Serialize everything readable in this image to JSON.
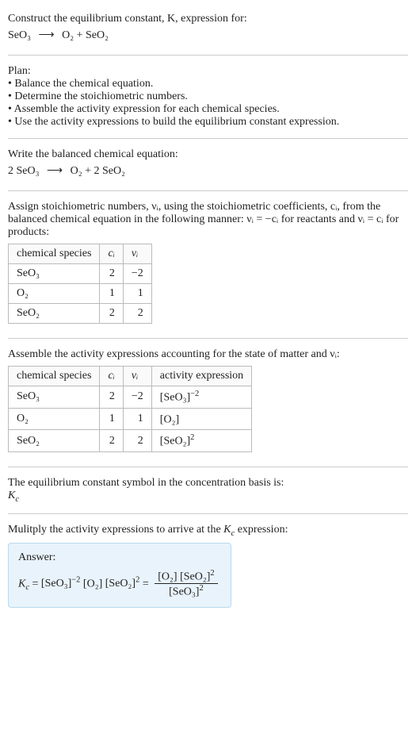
{
  "intro": {
    "line1": "Construct the equilibrium constant, K, expression for:",
    "eq_lhs": "SeO₃",
    "arrow": "⟶",
    "eq_rhs": "O₂ + SeO₂"
  },
  "plan": {
    "heading": "Plan:",
    "items": [
      "Balance the chemical equation.",
      "Determine the stoichiometric numbers.",
      "Assemble the activity expression for each chemical species.",
      "Use the activity expressions to build the equilibrium constant expression."
    ]
  },
  "balanced": {
    "heading": "Write the balanced chemical equation:",
    "lhs": "2 SeO₃",
    "arrow": "⟶",
    "rhs": "O₂ + 2 SeO₂"
  },
  "assign": {
    "text": "Assign stoichiometric numbers, νᵢ, using the stoichiometric coefficients, cᵢ, from the balanced chemical equation in the following manner: νᵢ = −cᵢ for reactants and νᵢ = cᵢ for products:"
  },
  "table1": {
    "headers": [
      "chemical species",
      "cᵢ",
      "νᵢ"
    ],
    "rows": [
      [
        "SeO₃",
        "2",
        "−2"
      ],
      [
        "O₂",
        "1",
        "1"
      ],
      [
        "SeO₂",
        "2",
        "2"
      ]
    ]
  },
  "assemble": {
    "text": "Assemble the activity expressions accounting for the state of matter and νᵢ:"
  },
  "table2": {
    "headers": [
      "chemical species",
      "cᵢ",
      "νᵢ",
      "activity expression"
    ],
    "rows": [
      {
        "sp": "SeO₃",
        "c": "2",
        "v": "−2",
        "act_base": "[SeO₃]",
        "act_exp": "−2"
      },
      {
        "sp": "O₂",
        "c": "1",
        "v": "1",
        "act_base": "[O₂]",
        "act_exp": ""
      },
      {
        "sp": "SeO₂",
        "c": "2",
        "v": "2",
        "act_base": "[SeO₂]",
        "act_exp": "2"
      }
    ]
  },
  "basis": {
    "line1": "The equilibrium constant symbol in the concentration basis is:",
    "symbol": "K_c"
  },
  "multiply": {
    "text": "Mulitply the activity expressions to arrive at the K_c expression:"
  },
  "answer": {
    "label": "Answer:",
    "kc": "K_c",
    "eq": "=",
    "t1_base": "[SeO₃]",
    "t1_exp": "−2",
    "t2_base": "[O₂]",
    "t3_base": "[SeO₂]",
    "t3_exp": "2",
    "num1": "[O₂]",
    "num2_base": "[SeO₂]",
    "num2_exp": "2",
    "den_base": "[SeO₃]",
    "den_exp": "2"
  }
}
